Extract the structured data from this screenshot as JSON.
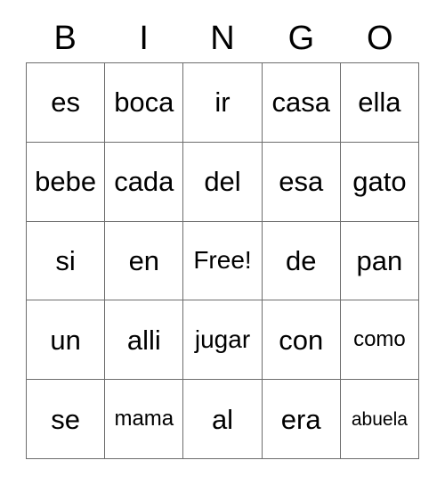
{
  "card": {
    "title": "BINGO",
    "free_space_label": "Free!",
    "border_color": "#6d6d6d",
    "text_color": "#000000",
    "background_color": "#ffffff"
  },
  "header": {
    "letters": [
      "B",
      "I",
      "N",
      "G",
      "O"
    ]
  },
  "grid": {
    "columns": 5,
    "rows": 5,
    "cells": [
      [
        {
          "text": "es",
          "size": "size-lg"
        },
        {
          "text": "boca",
          "size": "size-lg"
        },
        {
          "text": "ir",
          "size": "size-lg"
        },
        {
          "text": "casa",
          "size": "size-lg"
        },
        {
          "text": "ella",
          "size": "size-lg"
        }
      ],
      [
        {
          "text": "bebe",
          "size": "size-lg"
        },
        {
          "text": "cada",
          "size": "size-lg"
        },
        {
          "text": "del",
          "size": "size-lg"
        },
        {
          "text": "esa",
          "size": "size-lg"
        },
        {
          "text": "gato",
          "size": "size-lg"
        }
      ],
      [
        {
          "text": "si",
          "size": "size-lg"
        },
        {
          "text": "en",
          "size": "size-lg"
        },
        {
          "text": "Free!",
          "size": "size-md"
        },
        {
          "text": "de",
          "size": "size-lg"
        },
        {
          "text": "pan",
          "size": "size-lg"
        }
      ],
      [
        {
          "text": "un",
          "size": "size-lg"
        },
        {
          "text": "alli",
          "size": "size-lg"
        },
        {
          "text": "jugar",
          "size": "size-md"
        },
        {
          "text": "con",
          "size": "size-lg"
        },
        {
          "text": "como",
          "size": "size-sm"
        }
      ],
      [
        {
          "text": "se",
          "size": "size-lg"
        },
        {
          "text": "mama",
          "size": "size-sm"
        },
        {
          "text": "al",
          "size": "size-lg"
        },
        {
          "text": "era",
          "size": "size-lg"
        },
        {
          "text": "abuela",
          "size": "size-xs"
        }
      ]
    ]
  }
}
